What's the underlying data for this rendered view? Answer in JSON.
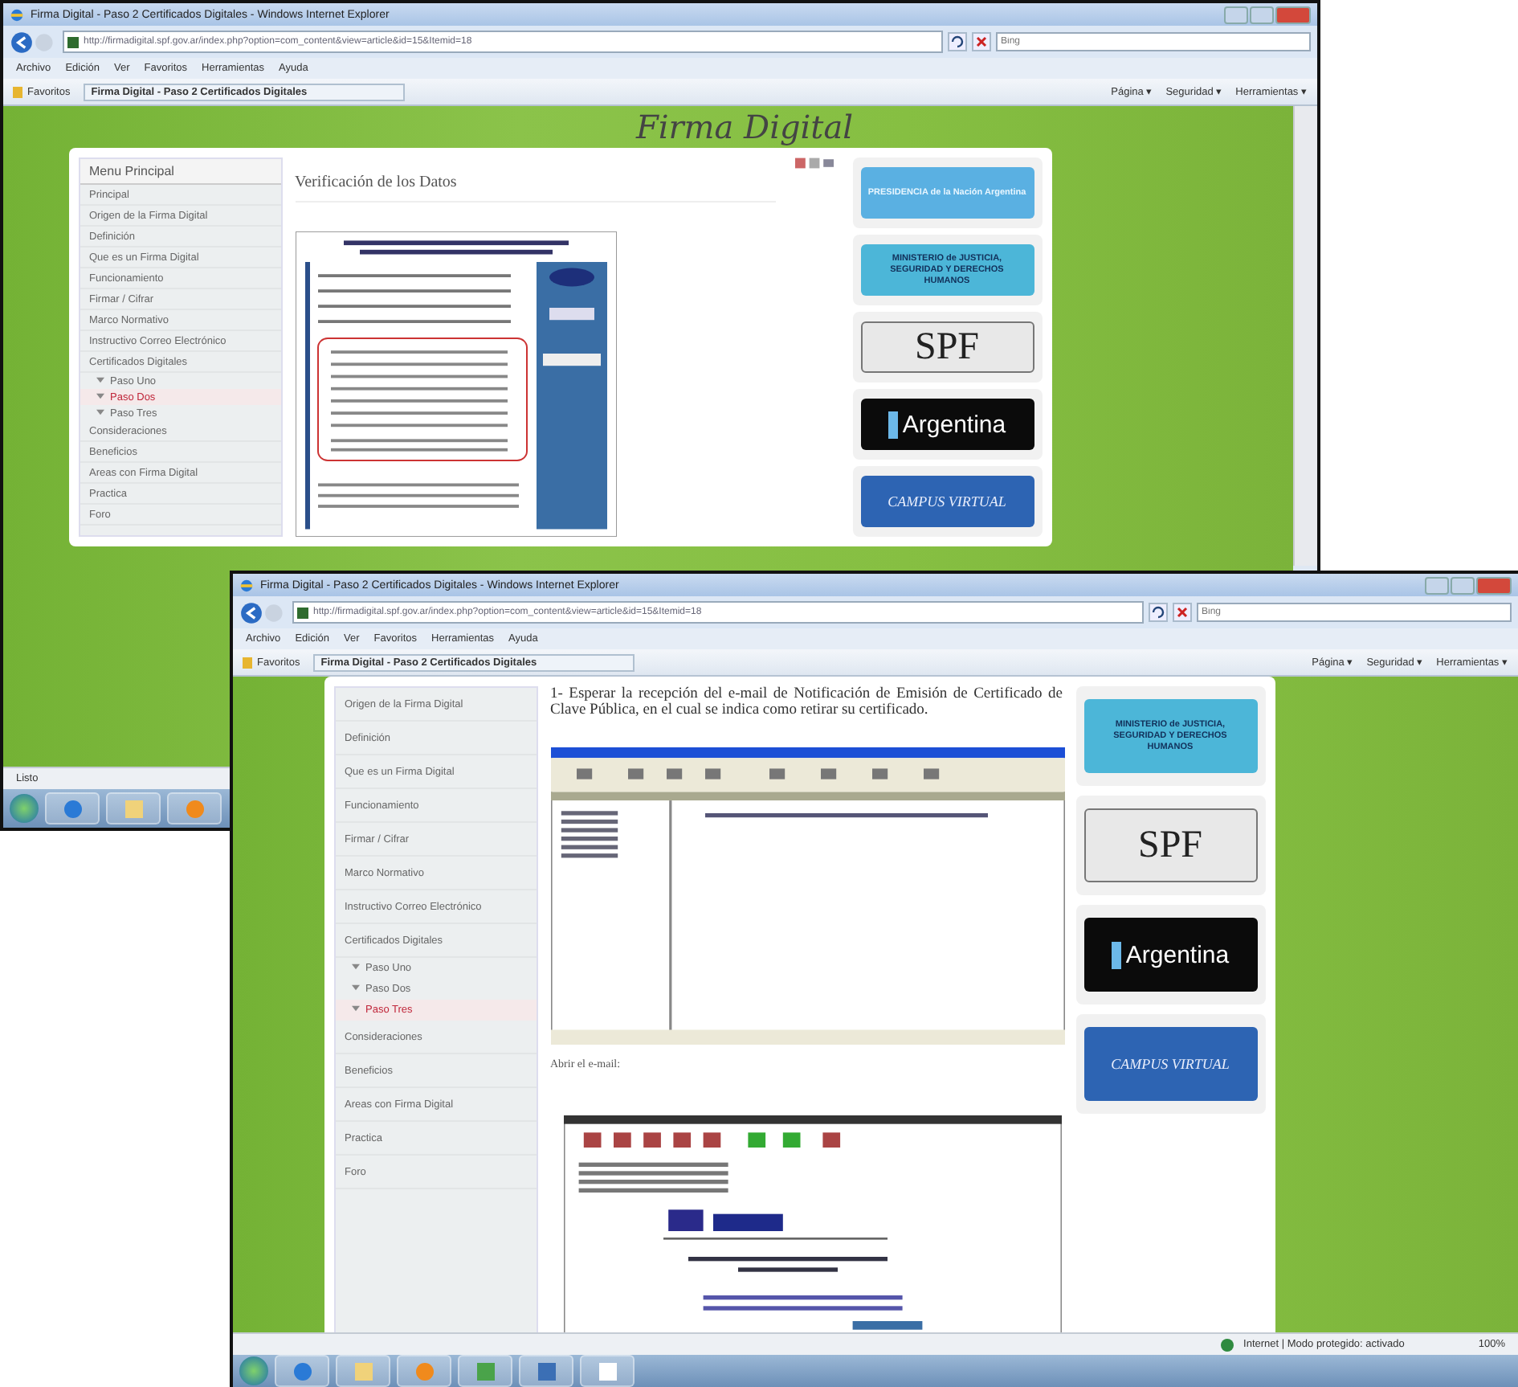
{
  "windows": [
    {
      "kind": "back",
      "title": "Firma Digital - Paso 2 Certificados Digitales - Windows Internet Explorer",
      "address": "http://firmadigital.spf.gov.ar/index.php?option=com_content&view=article&id=15&Itemid=18",
      "search": {
        "placeholder": "Bing"
      },
      "menu": [
        "Archivo",
        "Edición",
        "Ver",
        "Favoritos",
        "Herramientas",
        "Ayuda"
      ],
      "favorites": "Favoritos",
      "tab": "Firma Digital - Paso 2 Certificados Digitales",
      "commands": [
        "Página ▾",
        "Seguridad ▾",
        "Herramientas ▾"
      ],
      "page": {
        "banner": "Firma Digital",
        "sidebar_title": "Menu Principal",
        "sidebar": [
          {
            "label": "Principal",
            "selected": false
          },
          {
            "label": "Origen de la Firma Digital",
            "selected": false
          },
          {
            "label": "Definición",
            "selected": false
          },
          {
            "label": "Que es un Firma Digital",
            "selected": false
          },
          {
            "label": "Funcionamiento",
            "selected": false
          },
          {
            "label": "Firmar / Cifrar",
            "selected": false
          },
          {
            "label": "Marco Normativo",
            "selected": false
          },
          {
            "label": "Instructivo Correo Electrónico",
            "selected": false
          },
          {
            "label": "Certificados Digitales",
            "selected": false,
            "children": [
              {
                "label": "Paso Uno",
                "selected": false
              },
              {
                "label": "Paso Dos",
                "selected": true
              },
              {
                "label": "Paso Tres",
                "selected": false
              }
            ]
          },
          {
            "label": "Consideraciones",
            "selected": false
          },
          {
            "label": "Beneficios",
            "selected": false
          },
          {
            "label": "Areas con Firma Digital",
            "selected": false
          },
          {
            "label": "Practica",
            "selected": false
          },
          {
            "label": "Foro",
            "selected": false
          }
        ],
        "blocks": [
          {
            "kind": "heading",
            "text": "Verificación de los Datos"
          },
          {
            "kind": "document"
          }
        ],
        "logos": [
          {
            "kind": "presidencia",
            "text": "PRESIDENCIA de la Nación Argentina"
          },
          {
            "kind": "ministerio",
            "text": "MINISTERIO de JUSTICIA, SEGURIDAD Y DERECHOS HUMANOS"
          },
          {
            "kind": "spf",
            "text": "SPF"
          },
          {
            "kind": "argentina",
            "text": "Argentina"
          },
          {
            "kind": "campus",
            "text": "CAMPUS VIRTUAL"
          }
        ]
      },
      "status": "Listo"
    },
    {
      "kind": "front",
      "title": "Firma Digital - Paso 2 Certificados Digitales - Windows Internet Explorer",
      "address": "http://firmadigital.spf.gov.ar/index.php?option=com_content&view=article&id=15&Itemid=18",
      "search": {
        "placeholder": "Bing"
      },
      "menu": [
        "Archivo",
        "Edición",
        "Ver",
        "Favoritos",
        "Herramientas",
        "Ayuda"
      ],
      "favorites": "Favoritos",
      "tab": "Firma Digital - Paso 2 Certificados Digitales",
      "commands": [
        "Página ▾",
        "Seguridad ▾",
        "Herramientas ▾"
      ],
      "page": {
        "sidebar": [
          {
            "label": "Origen de la Firma Digital",
            "selected": false
          },
          {
            "label": "Definición",
            "selected": false
          },
          {
            "label": "Que es un Firma Digital",
            "selected": false
          },
          {
            "label": "Funcionamiento",
            "selected": false
          },
          {
            "label": "Firmar / Cifrar",
            "selected": false
          },
          {
            "label": "Marco Normativo",
            "selected": false
          },
          {
            "label": "Instructivo Correo Electrónico",
            "selected": false
          },
          {
            "label": "Certificados Digitales",
            "selected": false,
            "children": [
              {
                "label": "Paso Uno",
                "selected": false
              },
              {
                "label": "Paso Dos",
                "selected": false
              },
              {
                "label": "Paso Tres",
                "selected": true
              }
            ]
          },
          {
            "label": "Consideraciones",
            "selected": false
          },
          {
            "label": "Beneficios",
            "selected": false
          },
          {
            "label": "Areas con Firma Digital",
            "selected": false
          },
          {
            "label": "Practica",
            "selected": false
          },
          {
            "label": "Foro",
            "selected": false
          }
        ],
        "blocks": [
          {
            "kind": "paragraph",
            "text": "1- Esperar la recepción del e-mail de Notificación de Emisión de Certificado de Clave Pública, en el cual se indica como retirar su certificado."
          },
          {
            "kind": "mail-client"
          },
          {
            "kind": "caption",
            "text": "Abrir el e-mail:"
          },
          {
            "kind": "mail-message"
          }
        ],
        "logos": [
          {
            "kind": "ministerio",
            "text": "MINISTERIO de JUSTICIA, SEGURIDAD Y DERECHOS HUMANOS"
          },
          {
            "kind": "spf",
            "text": "SPF"
          },
          {
            "kind": "argentina",
            "text": "Argentina"
          },
          {
            "kind": "campus",
            "text": "CAMPUS VIRTUAL"
          }
        ]
      },
      "status": "Internet | Modo protegido: activado",
      "zoom": "100%"
    }
  ]
}
